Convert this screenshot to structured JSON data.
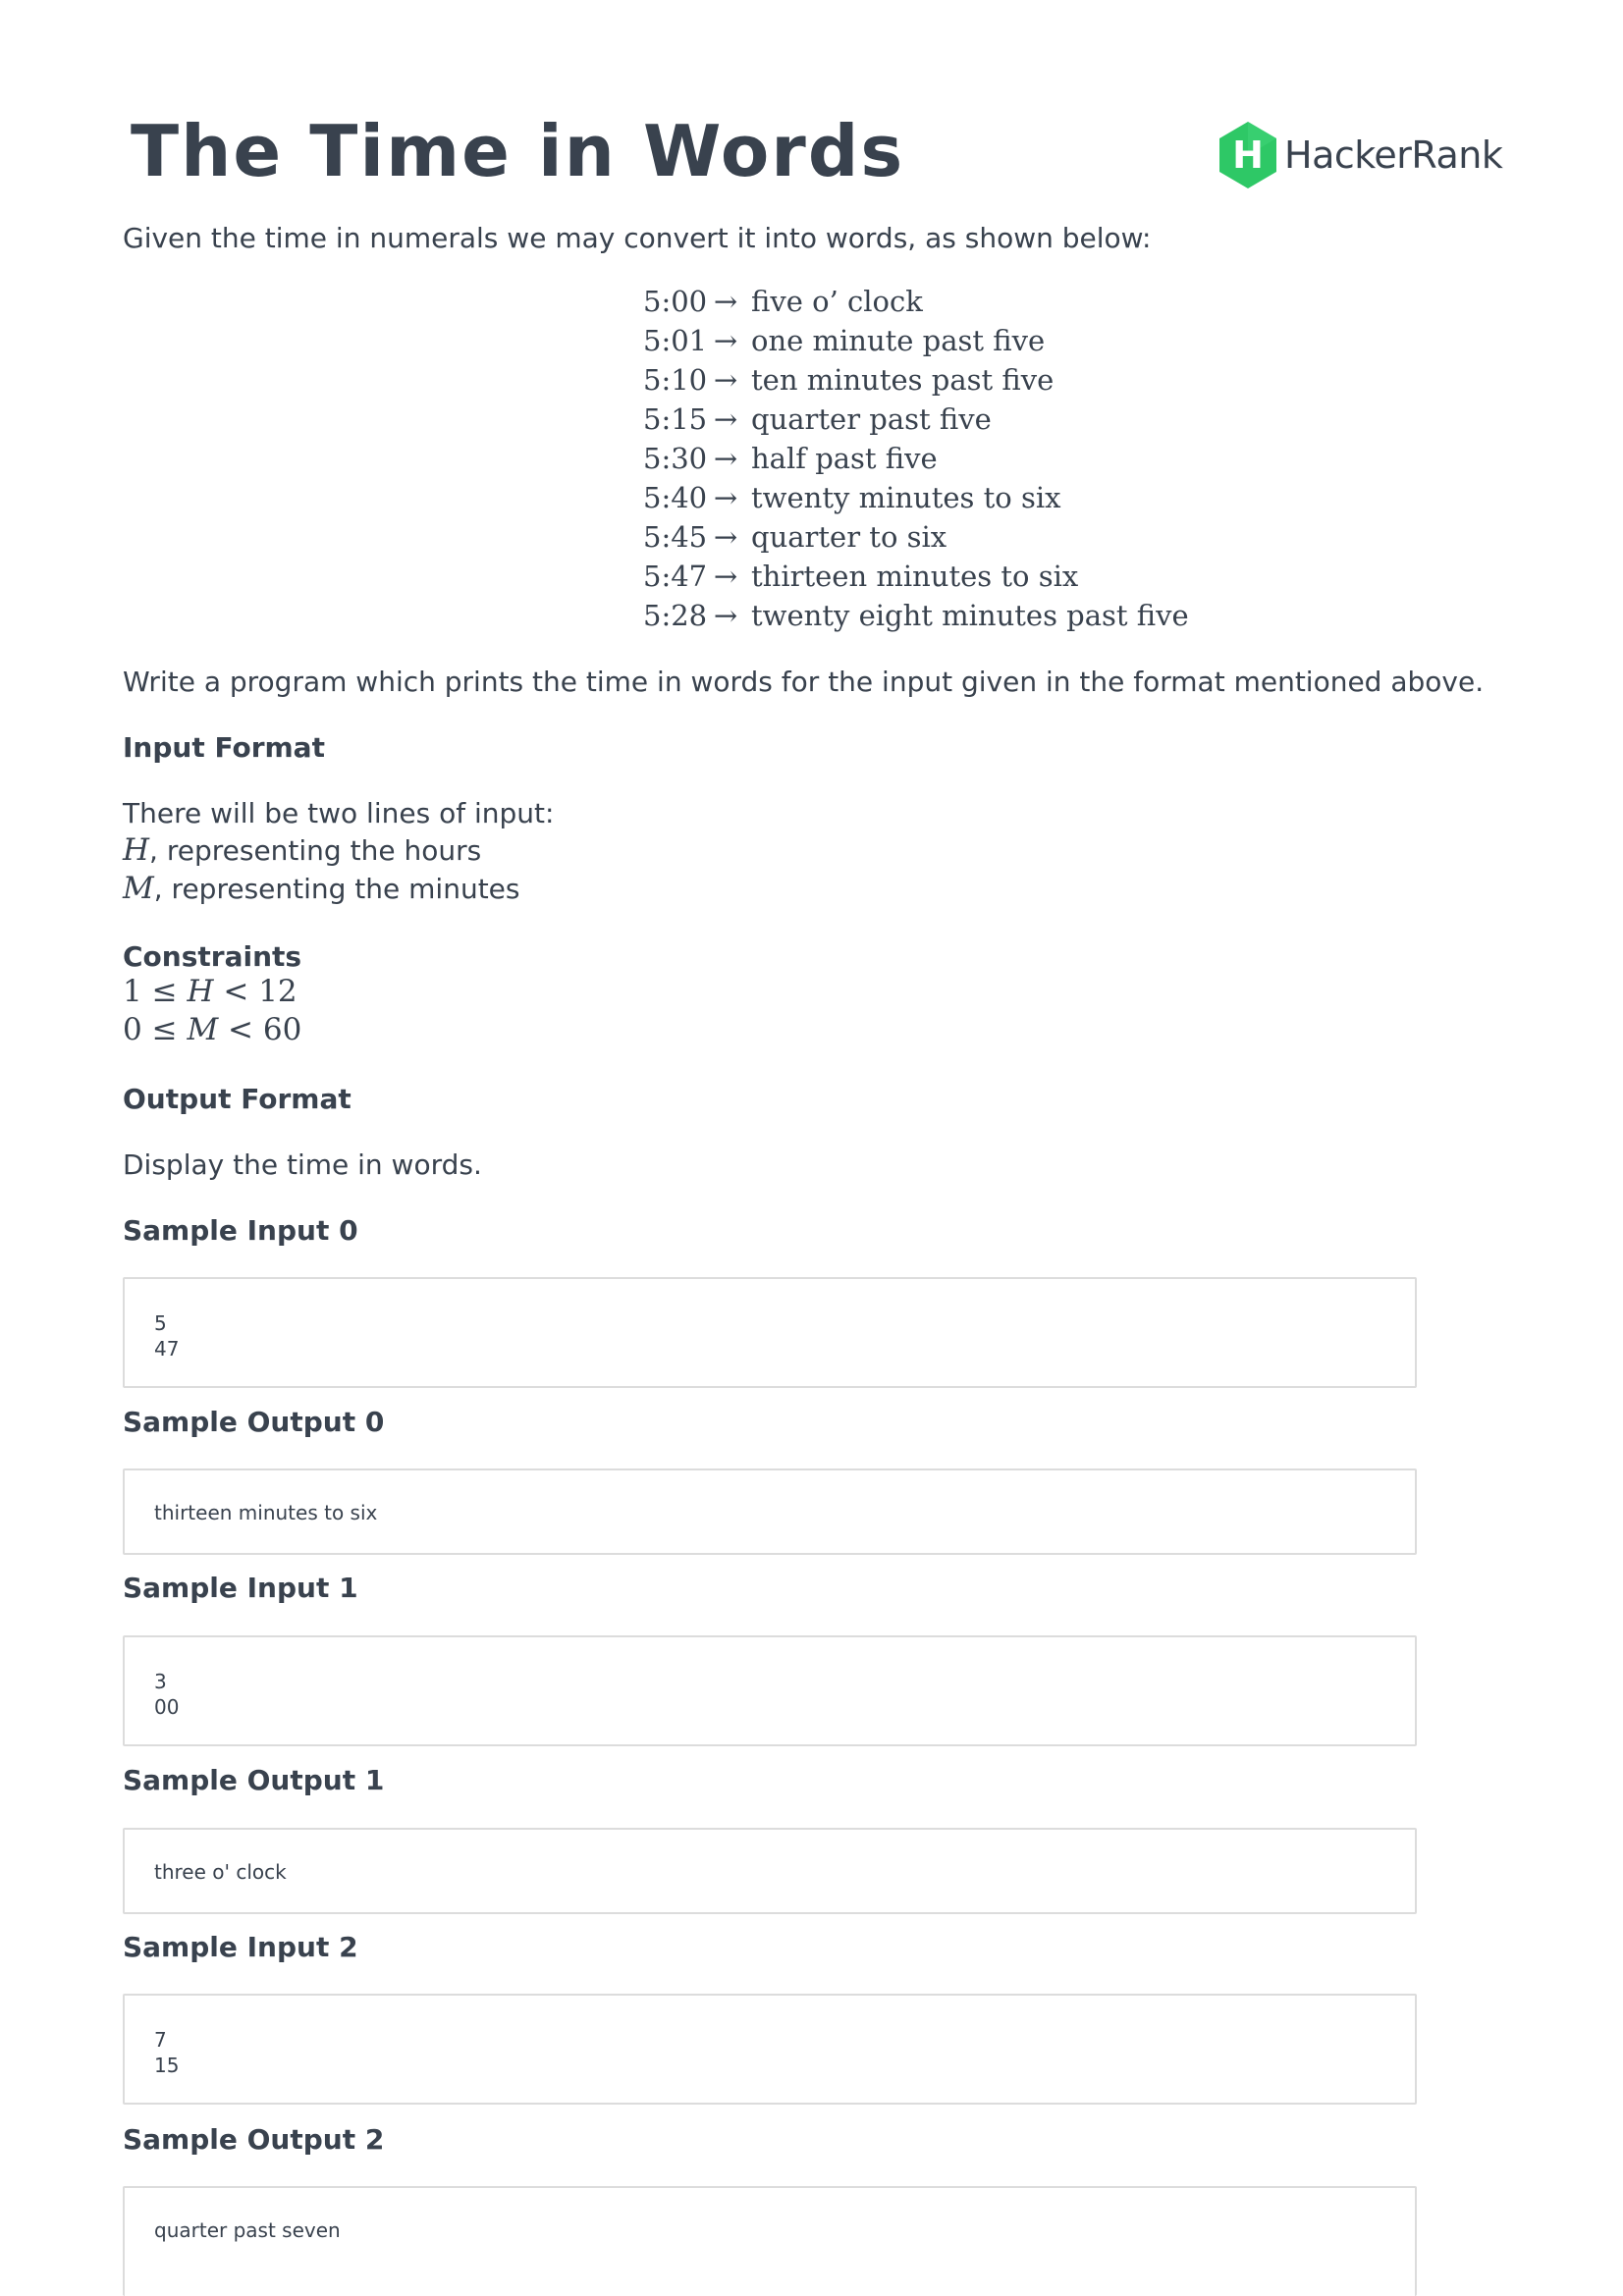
{
  "header": {
    "title": "The Time in Words",
    "logo_text": "HackerRank",
    "brand_color": "#2ec866"
  },
  "intro": "Given the time in numerals we may convert it into words, as shown below:",
  "conversions": [
    {
      "time": "5:00",
      "words": "five o’ clock"
    },
    {
      "time": "5:01",
      "words": "one minute past five"
    },
    {
      "time": "5:10",
      "words": "ten minutes past five"
    },
    {
      "time": "5:15",
      "words": "quarter past five"
    },
    {
      "time": "5:30",
      "words": "half past five"
    },
    {
      "time": "5:40",
      "words": "twenty minutes to six"
    },
    {
      "time": "5:45",
      "words": "quarter to six"
    },
    {
      "time": "5:47",
      "words": "thirteen minutes to six"
    },
    {
      "time": "5:28",
      "words": "twenty eight minutes past five"
    }
  ],
  "arrow": "→",
  "task": "Write a program which prints the time in words for the input given in the format mentioned above.",
  "input_format": {
    "heading": "Input Format",
    "line1": "There will be two lines of input:",
    "h_var": "H",
    "h_text": ", representing the hours",
    "m_var": "M",
    "m_text": ", representing the minutes"
  },
  "constraints": {
    "heading": "Constraints",
    "c1": {
      "lo": "1",
      "op1": "≤",
      "var": "H",
      "op2": "<",
      "hi": "12"
    },
    "c2": {
      "lo": "0",
      "op1": "≤",
      "var": "M",
      "op2": "<",
      "hi": "60"
    }
  },
  "output_format": {
    "heading": "Output Format",
    "text": "Display the time in words."
  },
  "samples": [
    {
      "heading": "Sample Input 0",
      "content": "5\n47"
    },
    {
      "heading": "Sample Output 0",
      "content": "thirteen minutes to six"
    },
    {
      "heading": "Sample Input 1",
      "content": "3\n00"
    },
    {
      "heading": "Sample Output 1",
      "content": "three o' clock"
    },
    {
      "heading": "Sample Input 2",
      "content": "7\n15"
    },
    {
      "heading": "Sample Output 2",
      "content": "quarter past seven"
    }
  ]
}
